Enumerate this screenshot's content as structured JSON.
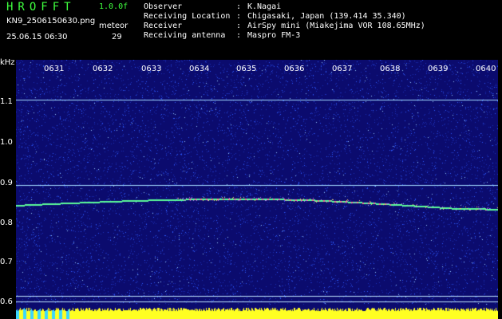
{
  "header": {
    "app_name": "HROFFT",
    "speed": "1.0.0f",
    "filename": "KN9_2506150630.png",
    "meteor_label": "meteor",
    "timestamp": "25.06.15 06:30",
    "meteor_count": "29"
  },
  "info": [
    {
      "key": "Observer",
      "value": "K.Nagai"
    },
    {
      "key": "Receiving Location",
      "value": "Chigasaki, Japan (139.414 35.340)"
    },
    {
      "key": "Receiver",
      "value": "AirSpy mini (Miakejima VOR 108.65MHz)"
    },
    {
      "key": "Receiving antenna",
      "value": "Maspro FM-3"
    }
  ],
  "plot": {
    "unit": "kHz",
    "y_ticks": [
      "1.1",
      "1.0",
      "0.9",
      "0.8",
      "0.7",
      "0.6"
    ],
    "x_ticks": [
      "0631",
      "0632",
      "0633",
      "0634",
      "0635",
      "0636",
      "0637",
      "0638",
      "0639",
      "0640"
    ],
    "colors": {
      "background": "#0b0b6e",
      "noise": "#2d5bff",
      "reference_line": "#9fd8ff",
      "trace": "#5dff9a",
      "trace_hot": "#ff6a9a",
      "level_bar": "#ffff22",
      "level_bar_low": "#3ad6ff"
    }
  }
}
